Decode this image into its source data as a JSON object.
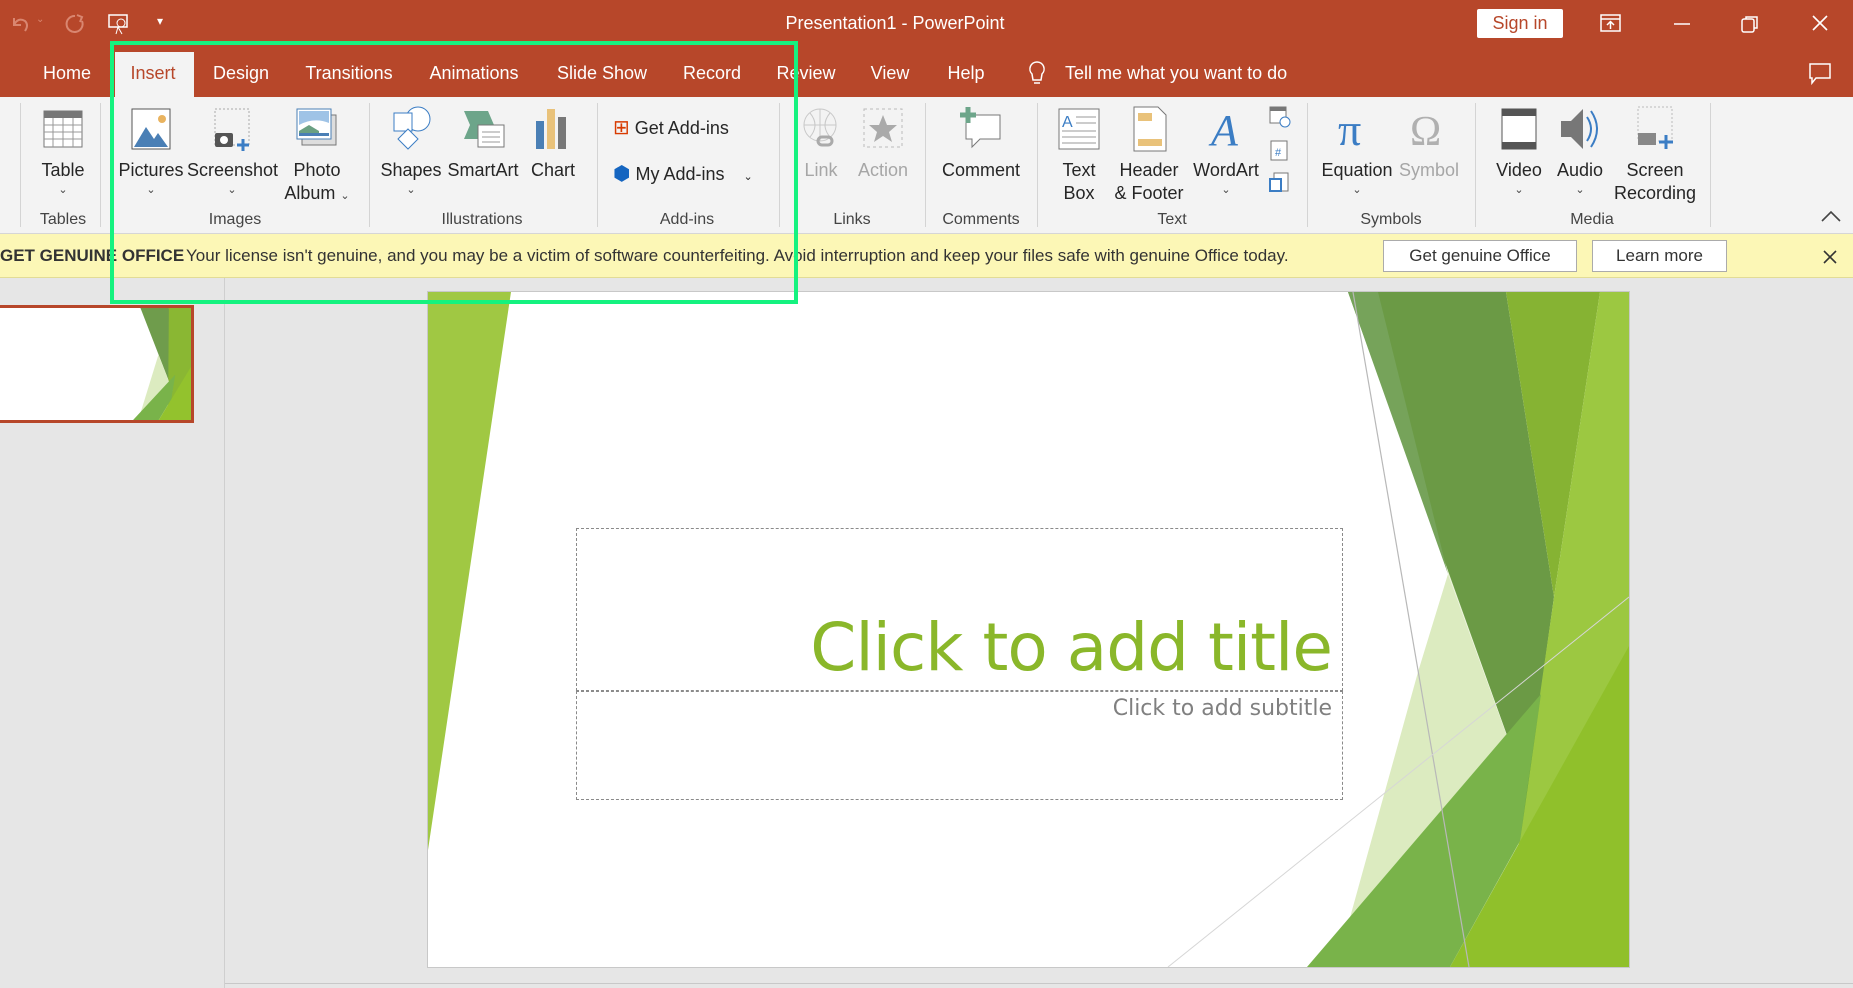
{
  "titlebar": {
    "title": "Presentation1  -  PowerPoint",
    "sign_in": "Sign in",
    "icons": [
      "undo-icon",
      "redo-icon",
      "present-from-start-icon",
      "customize-toolbar-icon",
      "ribbon-display-options-icon",
      "minimize-icon",
      "restore-icon",
      "close-icon"
    ]
  },
  "tabs": [
    {
      "label": "Home"
    },
    {
      "label": "Insert",
      "active": true
    },
    {
      "label": "Design"
    },
    {
      "label": "Transitions"
    },
    {
      "label": "Animations"
    },
    {
      "label": "Slide Show"
    },
    {
      "label": "Record"
    },
    {
      "label": "Review"
    },
    {
      "label": "View"
    },
    {
      "label": "Help"
    }
  ],
  "tell_me": "Tell me what you want to do",
  "ribbon": {
    "groups": {
      "tables": "Tables",
      "images": "Images",
      "illustrations": "Illustrations",
      "addins": "Add-ins",
      "links": "Links",
      "comments": "Comments",
      "text": "Text",
      "symbols": "Symbols",
      "media": "Media"
    },
    "table": "Table",
    "pictures": "Pictures",
    "screenshot": "Screenshot",
    "photo_album_1": "Photo",
    "photo_album_2": "Album",
    "shapes": "Shapes",
    "smartart": "SmartArt",
    "chart": "Chart",
    "get_addins": "Get Add-ins",
    "my_addins": "My Add-ins",
    "link": "Link",
    "action": "Action",
    "comment": "Comment",
    "textbox_1": "Text",
    "textbox_2": "Box",
    "header_1": "Header",
    "header_2": "& Footer",
    "wordart": "WordArt",
    "equation": "Equation",
    "symbol": "Symbol",
    "video": "Video",
    "audio": "Audio",
    "screenrec_1": "Screen",
    "screenrec_2": "Recording"
  },
  "message_bar": {
    "title": "GET GENUINE OFFICE",
    "text": "Your license isn't genuine, and you may be a victim of software counterfeiting. Avoid interruption and keep your files safe with genuine Office today.",
    "button_primary": "Get genuine Office",
    "button_secondary": "Learn more"
  },
  "slide": {
    "title_placeholder": "Click to add title",
    "subtitle_placeholder": "Click to add subtitle"
  },
  "colors": {
    "titlebar": "#b7472a",
    "highlight": "#15f27f",
    "title_text": "#8ab72a",
    "message_bar": "#fcf7b6"
  }
}
